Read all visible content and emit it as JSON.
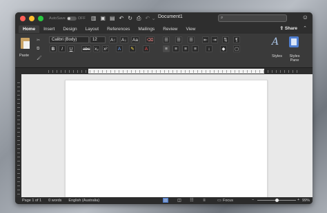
{
  "titlebar": {
    "autosave_label": "AutoSave",
    "autosave_state": "OFF",
    "doc_title": "Document1",
    "search_placeholder": "",
    "traffic_colors": [
      "#ff5f57",
      "#febc2e",
      "#28c840"
    ]
  },
  "tabs": [
    "Home",
    "Insert",
    "Design",
    "Layout",
    "References",
    "Mailings",
    "Review",
    "View"
  ],
  "share_label": "Share",
  "ribbon": {
    "paste_label": "Paste",
    "font_name": "Calibri (Body)",
    "font_size": "12",
    "styles_label": "Styles",
    "styles_pane_label": "Styles Pane"
  },
  "status": {
    "page": "Page 1 of 1",
    "words": "0 words",
    "language": "English (Australia)",
    "focus_label": "Focus",
    "zoom": "99%"
  },
  "accent": "#4f7ed0"
}
